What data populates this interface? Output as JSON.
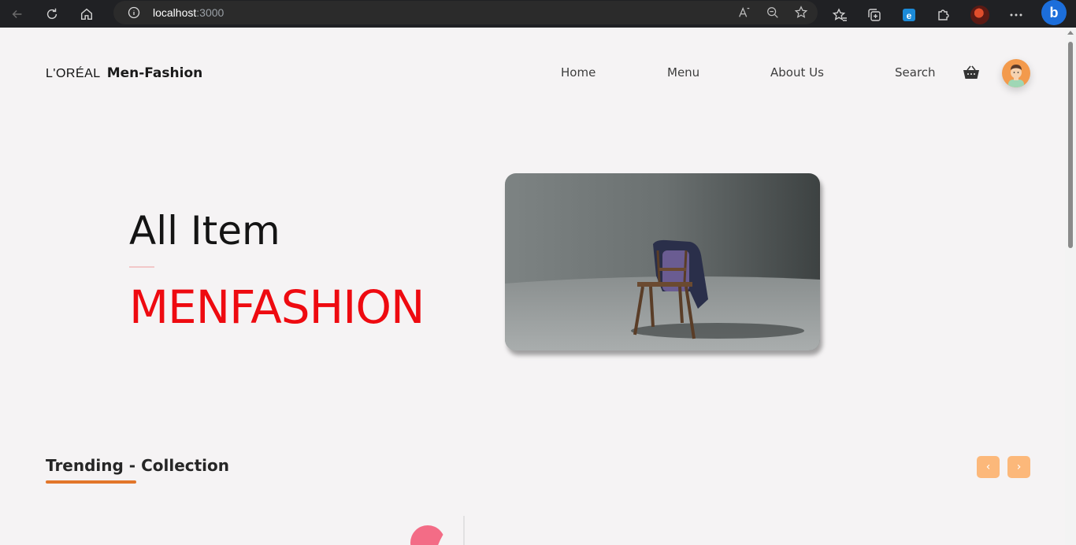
{
  "browser": {
    "url_host": "localhost",
    "url_port": ":3000"
  },
  "nav": {
    "brand_logo": "L'ORÉAL",
    "brand_name": "Men-Fashion",
    "items": [
      "Home",
      "Menu",
      "About Us",
      "Search"
    ]
  },
  "hero": {
    "title": "All Item",
    "brand": "MENFASHION"
  },
  "trending": {
    "title": "Trending - Collection",
    "prev_label": "‹",
    "next_label": "›"
  },
  "colors": {
    "accent_red": "#ee0a10",
    "accent_orange": "#e2762a",
    "button_orange": "#fcb87a",
    "avatar_bg": "#f39a4c",
    "page_bg": "#f5f3f4"
  },
  "icons": [
    "back-icon",
    "refresh-icon",
    "home-icon",
    "info-icon",
    "read-aloud-icon",
    "zoom-icon",
    "add-favorite-icon",
    "favorites-icon",
    "collections-icon",
    "edge-icon",
    "extensions-icon",
    "profile-icon",
    "more-icon",
    "copilot-icon",
    "basket-icon",
    "avatar-icon"
  ]
}
